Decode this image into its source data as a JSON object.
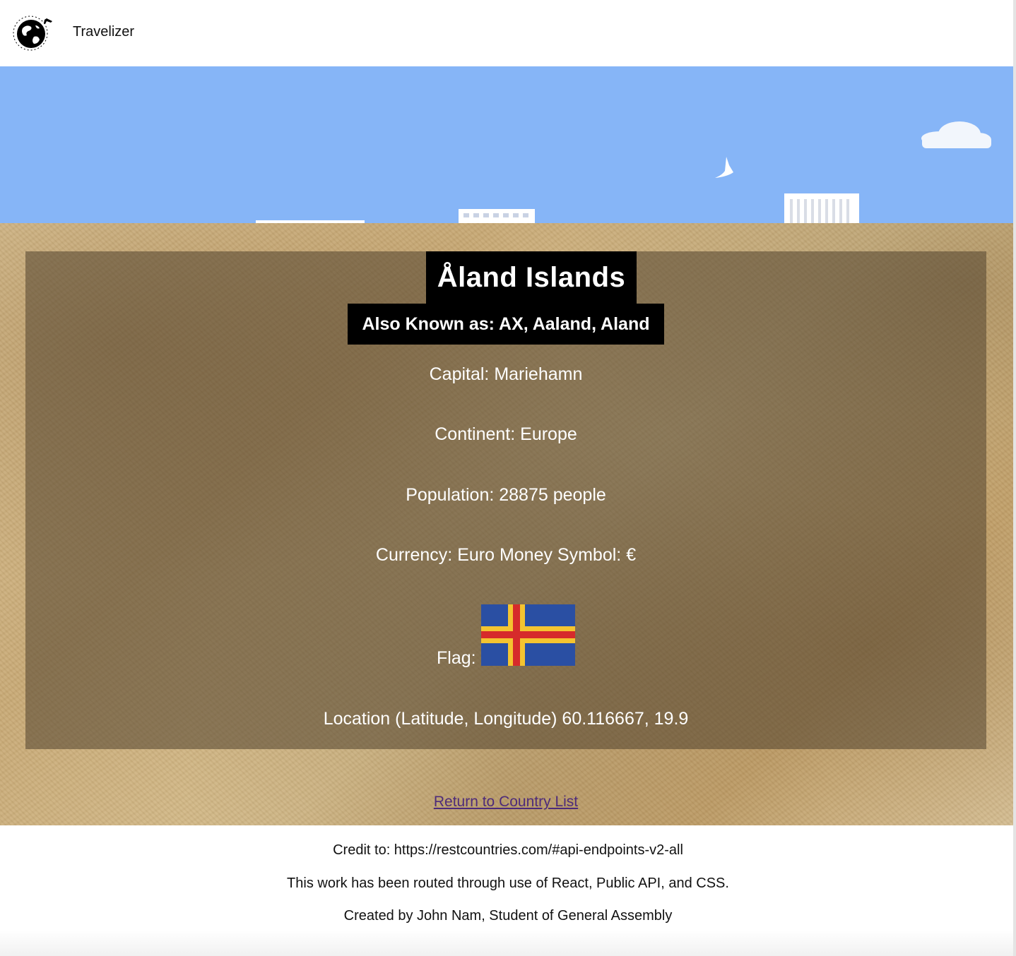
{
  "header": {
    "brand": "Travelizer",
    "logo_icon": "globe-airplane-icon"
  },
  "country": {
    "name": "Åland Islands",
    "also_known_as": "Also Known as: AX, Aaland, Aland",
    "capital": "Capital: Mariehamn",
    "continent": "Continent: Europe",
    "population": "Population: 28875 people",
    "currency": "Currency: Euro Money Symbol: €",
    "flag_label": "Flag:",
    "flag_icon": "aland-flag-icon",
    "location": "Location (Latitude, Longitude) 60.116667, 19.9"
  },
  "links": {
    "return": "Return to Country List"
  },
  "footer": {
    "credit": "Credit to: https://restcountries.com/#api-endpoints-v2-all",
    "routed": "This work has been routed through use of React, Public API, and CSS.",
    "created": "Created by John Nam, Student of General Assembly"
  },
  "colors": {
    "sky": "#86b5f7",
    "card_overlay": "rgba(80,66,45,0.55)",
    "link": "#4d2b7a",
    "flag_blue": "#2a4fa3",
    "flag_yellow": "#f4c430",
    "flag_red": "#d62b2b"
  }
}
